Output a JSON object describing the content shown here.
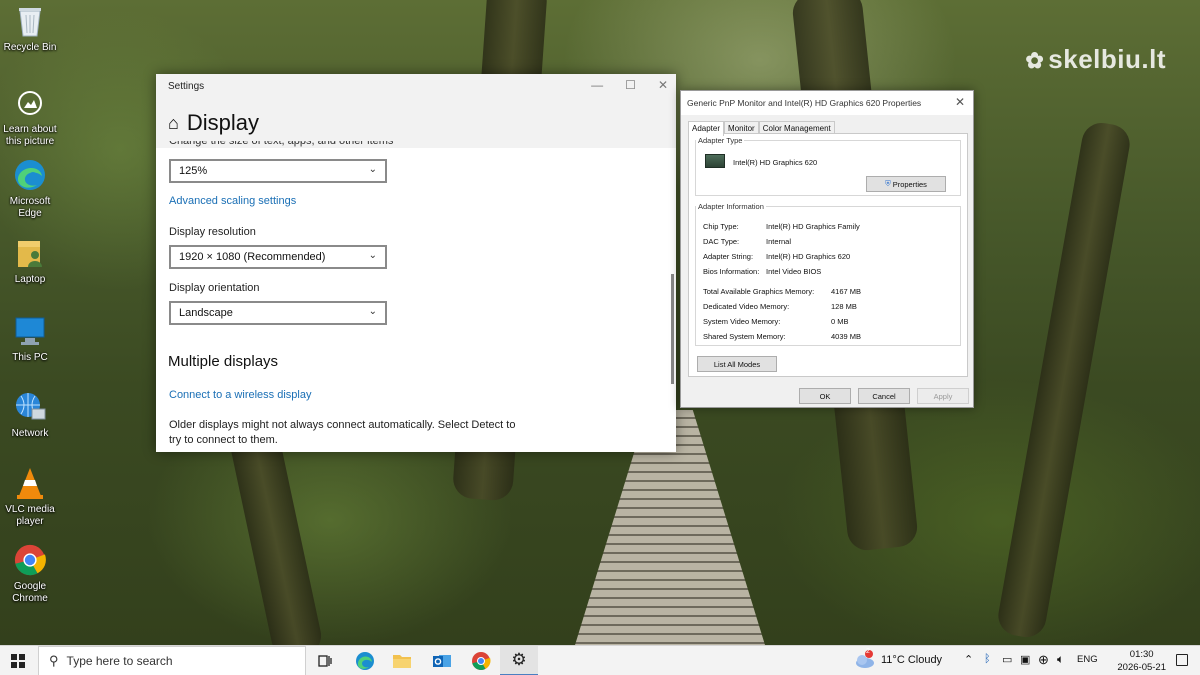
{
  "desktop": {
    "watermark": "skelbiu.lt",
    "icons": [
      {
        "label": "Recycle Bin"
      },
      {
        "label": "Learn about this picture"
      },
      {
        "label": "Microsoft Edge"
      },
      {
        "label": "Laptop"
      },
      {
        "label": "This PC"
      },
      {
        "label": "Network"
      },
      {
        "label": "VLC media player"
      },
      {
        "label": "Google Chrome"
      }
    ]
  },
  "settings": {
    "window_title": "Settings",
    "page_title": "Display",
    "scale_label_cut": "Change the size of text, apps, and other items",
    "scale_value": "125%",
    "advanced_scaling_link": "Advanced scaling settings",
    "resolution_label": "Display resolution",
    "resolution_value": "1920 × 1080 (Recommended)",
    "orientation_label": "Display orientation",
    "orientation_value": "Landscape",
    "multiple_displays_heading": "Multiple displays",
    "wireless_link": "Connect to a wireless display",
    "older_displays_text": "Older displays might not always connect automatically. Select Detect to try to connect to them."
  },
  "properties": {
    "title": "Generic PnP Monitor and Intel(R) HD Graphics 620 Properties",
    "tabs": [
      "Adapter",
      "Monitor",
      "Color Management"
    ],
    "adapter_type_legend": "Adapter Type",
    "adapter_name": "Intel(R) HD Graphics 620",
    "properties_button": "Properties",
    "adapter_info_legend": "Adapter Information",
    "info": [
      {
        "key": "Chip Type:",
        "value": "Intel(R) HD Graphics Family"
      },
      {
        "key": "DAC Type:",
        "value": "Internal"
      },
      {
        "key": "Adapter String:",
        "value": "Intel(R) HD Graphics 620"
      },
      {
        "key": "Bios Information:",
        "value": "Intel Video BIOS"
      }
    ],
    "memory": [
      {
        "key": "Total Available Graphics Memory:",
        "value": "4167 MB"
      },
      {
        "key": "Dedicated Video Memory:",
        "value": "128 MB"
      },
      {
        "key": "System Video Memory:",
        "value": "0 MB"
      },
      {
        "key": "Shared System Memory:",
        "value": "4039 MB"
      }
    ],
    "list_all_modes_button": "List All Modes",
    "ok_button": "OK",
    "cancel_button": "Cancel",
    "apply_button": "Apply"
  },
  "taskbar": {
    "search_placeholder": "Type here to search",
    "weather_badge": "2",
    "weather": "11°C  Cloudy",
    "language": "ENG",
    "time": "01:30",
    "date": "2026-05-21"
  }
}
